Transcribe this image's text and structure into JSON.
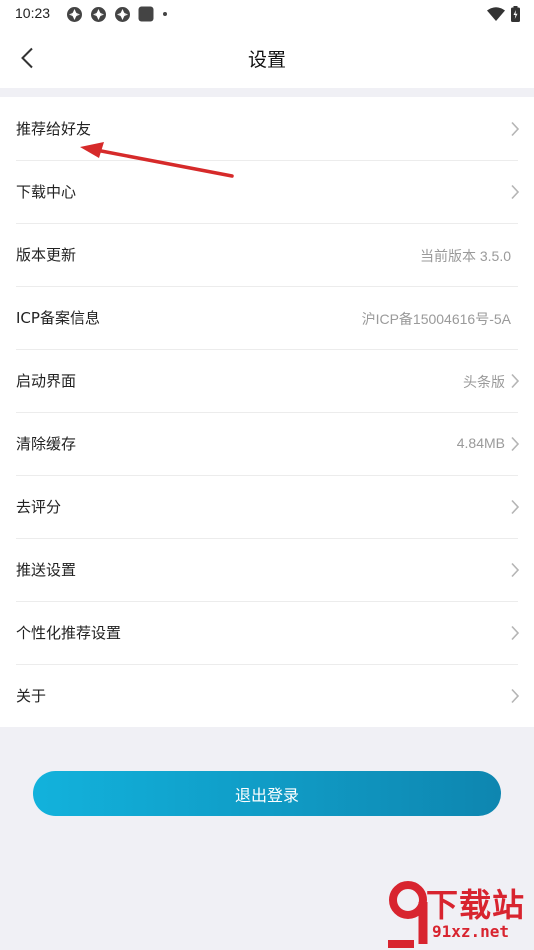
{
  "status_bar": {
    "time": "10:23",
    "notification_icons": [
      "app-notification-icon",
      "app-notification-icon",
      "app-notification-icon",
      "square-notification-icon",
      "dot-icon"
    ],
    "right_icons": [
      "wifi-icon",
      "battery-icon"
    ]
  },
  "header": {
    "back_icon": "chevron-left-icon",
    "title": "设置"
  },
  "menu": {
    "items": [
      {
        "label": "推荐给好友",
        "value": "",
        "chevron": true
      },
      {
        "label": "下载中心",
        "value": "",
        "chevron": true
      },
      {
        "label": "版本更新",
        "value": "当前版本 3.5.0",
        "chevron": false
      },
      {
        "label": "ICP备案信息",
        "value": "沪ICP备15004616号-5A",
        "chevron": false
      },
      {
        "label": "启动界面",
        "value": "头条版",
        "chevron": true
      },
      {
        "label": "清除缓存",
        "value": "4.84MB",
        "chevron": true
      },
      {
        "label": "去评分",
        "value": "",
        "chevron": true
      },
      {
        "label": "推送设置",
        "value": "",
        "chevron": true
      },
      {
        "label": "个性化推荐设置",
        "value": "",
        "chevron": true
      },
      {
        "label": "关于",
        "value": "",
        "chevron": true
      }
    ]
  },
  "logout": {
    "label": "退出登录"
  },
  "watermark": {
    "main": "下载站",
    "url": "91xz.net"
  },
  "colors": {
    "accent_start": "#12b2dc",
    "accent_end": "#0e86b0",
    "annotation_arrow": "#d62a2a",
    "watermark": "#d8242f"
  }
}
